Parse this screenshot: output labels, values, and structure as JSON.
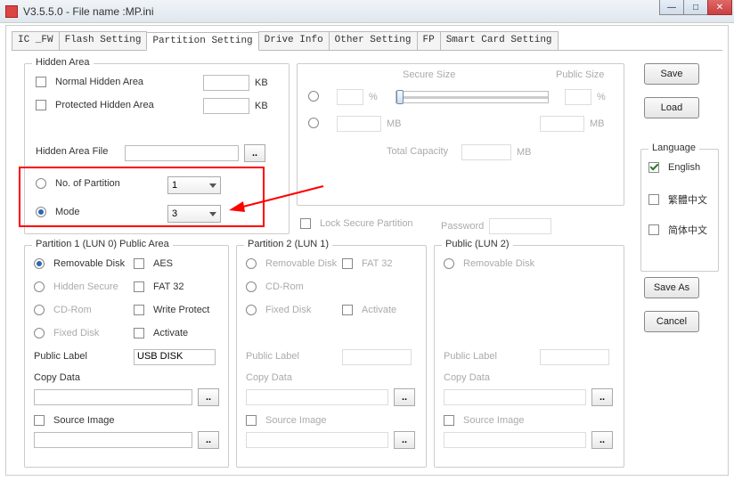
{
  "window": {
    "title": "V3.5.5.0 - File name :MP.ini"
  },
  "tabs": [
    "IC _FW",
    "Flash Setting",
    "Partition Setting",
    "Drive Info",
    "Other Setting",
    "FP",
    "Smart Card Setting"
  ],
  "hiddenArea": {
    "title": "Hidden Area",
    "normal": "Normal Hidden Area",
    "protected": "Protected Hidden Area",
    "kb": "KB",
    "fileLbl": "Hidden Area File",
    "browse": "..",
    "noPartition": "No. of Partition",
    "noPartitionVal": "1",
    "mode": "Mode",
    "modeVal": "3"
  },
  "secure": {
    "secureSize": "Secure Size",
    "publicSize": "Public Size",
    "pct": "%",
    "mb": "MB",
    "totalCap": "Total Capacity",
    "lock": "Lock Secure Partition",
    "password": "Password"
  },
  "p1": {
    "title": "Partition 1 (LUN 0) Public Area",
    "removable": "Removable Disk",
    "aes": "AES",
    "hidden": "Hidden Secure",
    "fat32": "FAT 32",
    "cdrom": "CD-Rom",
    "wp": "Write Protect",
    "fixed": "Fixed Disk",
    "activate": "Activate",
    "publicLabel": "Public Label",
    "publicLabelVal": "USB DISK",
    "copyData": "Copy Data",
    "source": "Source Image",
    "browse": ".."
  },
  "p2": {
    "title": "Partition 2 (LUN 1)",
    "removable": "Removable Disk",
    "fat32": "FAT 32",
    "cdrom": "CD-Rom",
    "fixed": "Fixed Disk",
    "activate": "Activate",
    "publicLabel": "Public Label",
    "copyData": "Copy Data",
    "source": "Source Image",
    "browse": ".."
  },
  "p3": {
    "title": "Public (LUN 2)",
    "removable": "Removable Disk",
    "publicLabel": "Public Label",
    "copyData": "Copy Data",
    "source": "Source Image",
    "browse": ".."
  },
  "side": {
    "save": "Save",
    "load": "Load",
    "lang": "Language",
    "english": "English",
    "trad": "繁體中文",
    "simp": "简体中文",
    "saveAs": "Save As",
    "cancel": "Cancel"
  }
}
